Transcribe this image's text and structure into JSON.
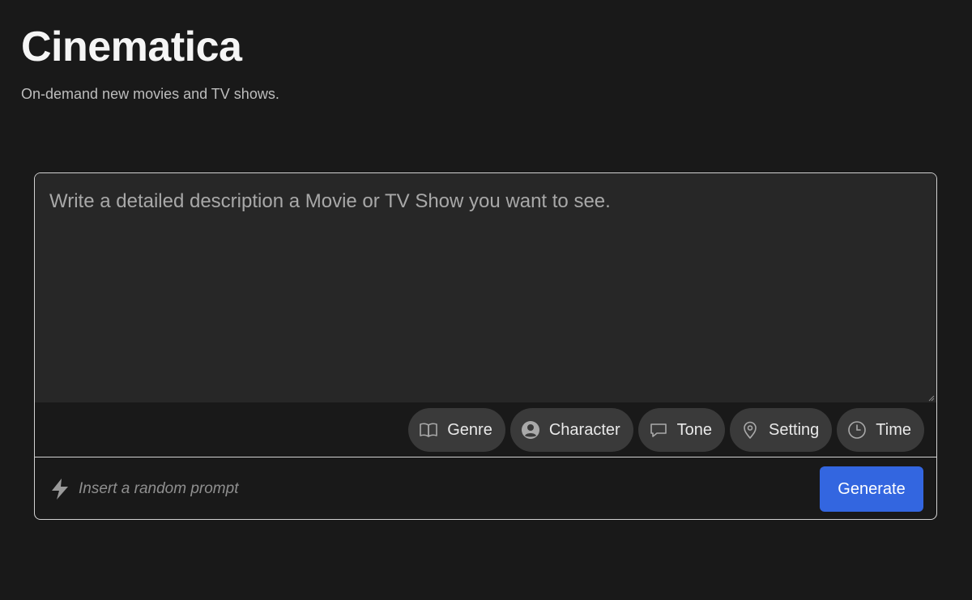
{
  "header": {
    "title": "Cinematica",
    "subtitle": "On-demand new movies and TV shows."
  },
  "prompt": {
    "placeholder": "Write a detailed description a Movie or TV Show you want to see.",
    "value": ""
  },
  "chips": [
    {
      "label": "Genre",
      "icon": "book-icon"
    },
    {
      "label": "Character",
      "icon": "user-circle-icon"
    },
    {
      "label": "Tone",
      "icon": "speech-bubble-icon"
    },
    {
      "label": "Setting",
      "icon": "map-pin-icon"
    },
    {
      "label": "Time",
      "icon": "clock-icon"
    }
  ],
  "footer": {
    "random_label": "Insert a random prompt",
    "random_icon": "lightning-bolt-icon",
    "generate_label": "Generate"
  },
  "colors": {
    "background": "#191919",
    "input": "#272727",
    "chip": "#3a3a3a",
    "accent": "#3366e0"
  }
}
